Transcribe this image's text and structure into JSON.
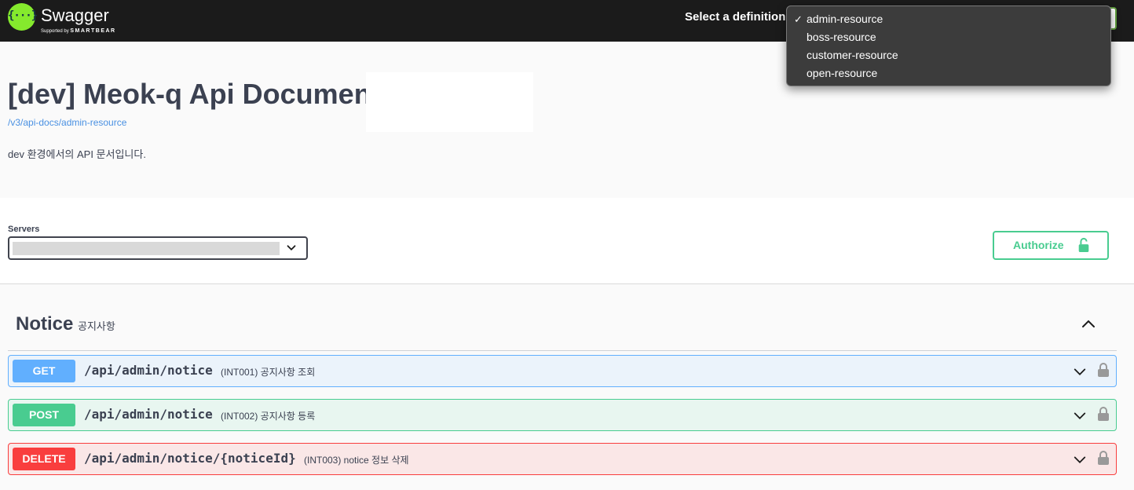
{
  "brand": {
    "icon_text": "{···}",
    "name": "Swagger",
    "supported_by": "Supported by",
    "company": "SMARTBEAR"
  },
  "topbar": {
    "select_label": "Select a definition"
  },
  "definitions": {
    "options": [
      "admin-resource",
      "boss-resource",
      "customer-resource",
      "open-resource"
    ],
    "selected": "admin-resource",
    "check_mark": "✓"
  },
  "info": {
    "title": "[dev] Meok-q Api Document",
    "url": "/v3/api-docs/admin-resource",
    "description": "dev 환경에서의 API 문서입니다."
  },
  "servers": {
    "label": "Servers"
  },
  "authorize": {
    "label": "Authorize"
  },
  "tag": {
    "name": "Notice",
    "description": "공지사항"
  },
  "operations": [
    {
      "method": "GET",
      "path": "/api/admin/notice",
      "summary": "(INT001) 공지사항 조회"
    },
    {
      "method": "POST",
      "path": "/api/admin/notice",
      "summary": "(INT002) 공지사항 등록"
    },
    {
      "method": "DELETE",
      "path": "/api/admin/notice/{noticeId}",
      "summary": "(INT003) notice 정보 삭제"
    }
  ],
  "colors": {
    "get": "#61affe",
    "post": "#49cc90",
    "delete": "#f93e3e",
    "brand_green": "#85ea2d",
    "link": "#4990e2"
  },
  "icons": {
    "authorize": "unlocked-lock-icon",
    "operation_lock": "lock-icon",
    "expand": "chevron-down-icon",
    "collapse": "chevron-up-icon"
  }
}
